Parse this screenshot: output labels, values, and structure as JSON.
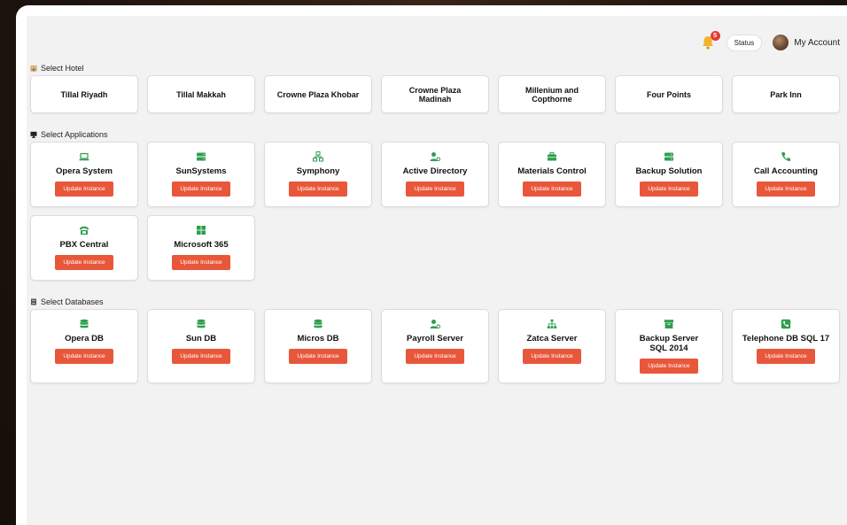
{
  "topbar": {
    "notification_count": "5",
    "status_label": "Status",
    "account_label": "My Account"
  },
  "hotels": {
    "section_label": "Select Hotel",
    "items": [
      {
        "name": "Tillal Riyadh"
      },
      {
        "name": "Tillal Makkah"
      },
      {
        "name": "Crowne Plaza Khobar"
      },
      {
        "name": "Crowne Plaza Madinah"
      },
      {
        "name": "Millenium and Copthorne"
      },
      {
        "name": "Four Points"
      },
      {
        "name": "Park Inn"
      }
    ]
  },
  "applications": {
    "section_label": "Select Applications",
    "button_label": "Update Instance",
    "items": [
      {
        "name": "Opera System",
        "icon": "laptop-icon"
      },
      {
        "name": "SunSystems",
        "icon": "server-icon"
      },
      {
        "name": "Symphony",
        "icon": "network-icon"
      },
      {
        "name": "Active Directory",
        "icon": "user-gear-icon"
      },
      {
        "name": "Materials Control",
        "icon": "briefcase-icon"
      },
      {
        "name": "Backup Solution",
        "icon": "server-icon"
      },
      {
        "name": "Call Accounting",
        "icon": "phone-icon"
      },
      {
        "name": "PBX Central",
        "icon": "fax-icon"
      },
      {
        "name": "Microsoft 365",
        "icon": "windows-icon"
      }
    ]
  },
  "databases": {
    "section_label": "Select Databases",
    "button_label": "Update Instance",
    "items": [
      {
        "name": "Opera DB",
        "icon": "database-icon"
      },
      {
        "name": "Sun DB",
        "icon": "database-icon"
      },
      {
        "name": "Micros DB",
        "icon": "database-icon"
      },
      {
        "name": "Payroll Server",
        "icon": "user-gear-icon"
      },
      {
        "name": "Zatca Server",
        "icon": "sitemap-icon"
      },
      {
        "name": "Backup Server SQL 2014",
        "icon": "archive-icon"
      },
      {
        "name": "Telephone DB SQL 17",
        "icon": "phone-square-icon"
      }
    ]
  },
  "colors": {
    "accent_button": "#e8573a",
    "icon_green": "#2e9e4f",
    "background": "#f2f2f2"
  }
}
